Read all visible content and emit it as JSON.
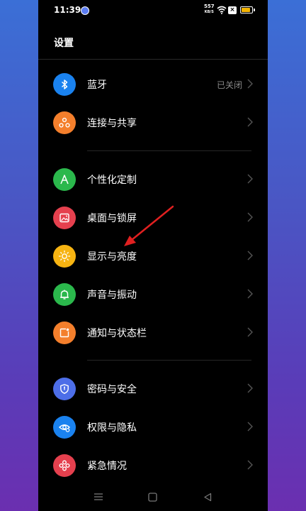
{
  "status_bar": {
    "time": "11:39",
    "net_speed_value": "557",
    "net_speed_unit": "KB/S",
    "sim_label": "×",
    "icons": [
      "notification-icon",
      "wifi-icon",
      "sim-icon",
      "battery-icon"
    ]
  },
  "header": {
    "title": "设置"
  },
  "settings": {
    "items": [
      {
        "label": "蓝牙",
        "value": "已关闭",
        "icon": "bluetooth-icon",
        "color": "#1a82ef"
      },
      {
        "label": "连接与共享",
        "value": "",
        "icon": "share-icon",
        "color": "#f47f2c"
      },
      {
        "label": "个性化定制",
        "value": "",
        "icon": "personalize-icon",
        "color": "#2bb84c"
      },
      {
        "label": "桌面与锁屏",
        "value": "",
        "icon": "wallpaper-icon",
        "color": "#e5404e"
      },
      {
        "label": "显示与亮度",
        "value": "",
        "icon": "brightness-icon",
        "color": "#f7b412"
      },
      {
        "label": "声音与振动",
        "value": "",
        "icon": "bell-icon",
        "color": "#2bb84c"
      },
      {
        "label": "通知与状态栏",
        "value": "",
        "icon": "notification-bar-icon",
        "color": "#f47f2c"
      },
      {
        "label": "密码与安全",
        "value": "",
        "icon": "shield-icon",
        "color": "#4d6ee8"
      },
      {
        "label": "权限与隐私",
        "value": "",
        "icon": "privacy-eye-icon",
        "color": "#1a82ef"
      },
      {
        "label": "紧急情况",
        "value": "",
        "icon": "emergency-icon",
        "color": "#e5404e"
      }
    ]
  },
  "annotation": {
    "arrow_color": "#e02020",
    "points_to": "显示与亮度"
  },
  "nav_bar": {
    "buttons": [
      "menu-icon",
      "home-icon",
      "back-icon"
    ]
  }
}
